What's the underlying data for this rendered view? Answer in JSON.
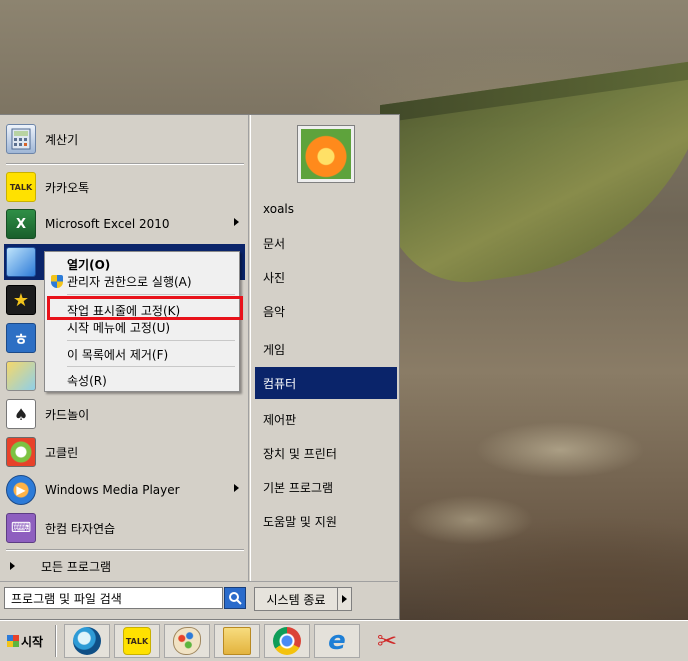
{
  "start_menu": {
    "pinned": [
      {
        "label": "계산기",
        "icon": "calculator-icon"
      },
      {
        "label": "카카오톡",
        "icon": "kakaotalk-icon",
        "icon_text": "TALK"
      }
    ],
    "recent": [
      {
        "label": "Microsoft Excel 2010",
        "icon": "excel-icon",
        "submenu": true
      },
      {
        "label": "",
        "icon": "blue-app-icon",
        "selected": true
      },
      {
        "label": "",
        "icon": "movie-maker-icon"
      },
      {
        "label": "",
        "icon": "hwp-icon",
        "icon_text": "ㅎ"
      },
      {
        "label": "",
        "icon": "paint-icon"
      },
      {
        "label": "카드놀이",
        "icon": "solitaire-icon"
      },
      {
        "label": "고클린",
        "icon": "goclean-icon"
      },
      {
        "label": "Windows Media Player",
        "icon": "media-player-icon",
        "submenu": true
      },
      {
        "label": "한컴 타자연습",
        "icon": "typing-icon"
      }
    ],
    "all_programs": "모든 프로그램",
    "search_placeholder": "프로그램 및 파일 검색",
    "shutdown_label": "시스템 종료",
    "right_items": [
      "xoals",
      "문서",
      "사진",
      "음악",
      "게임",
      "컴퓨터",
      "제어판",
      "장치 및 프린터",
      "기본 프로그램",
      "도움말 및 지원"
    ],
    "right_highlighted": "컴퓨터"
  },
  "context_menu": {
    "items": [
      "열기(O)",
      "관리자 권한으로 실행(A)",
      "작업 표시줄에 고정(K)",
      "시작 메뉴에 고정(U)",
      "이 목록에서 제거(F)",
      "속성(R)"
    ],
    "highlighted": "작업 표시줄에 고정(K)"
  },
  "taskbar": {
    "start_label": "시작",
    "buttons": [
      "app-bird-icon",
      "kakaotalk-icon",
      "paint-icon",
      "file-explorer-icon",
      "chrome-icon",
      "internet-explorer-icon",
      "snipping-tool-icon"
    ],
    "kakao_text": "TALK"
  },
  "colors": {
    "selection": "#0a246a",
    "highlight_box": "#e8121a",
    "menu_bg": "#d4d0c8"
  }
}
